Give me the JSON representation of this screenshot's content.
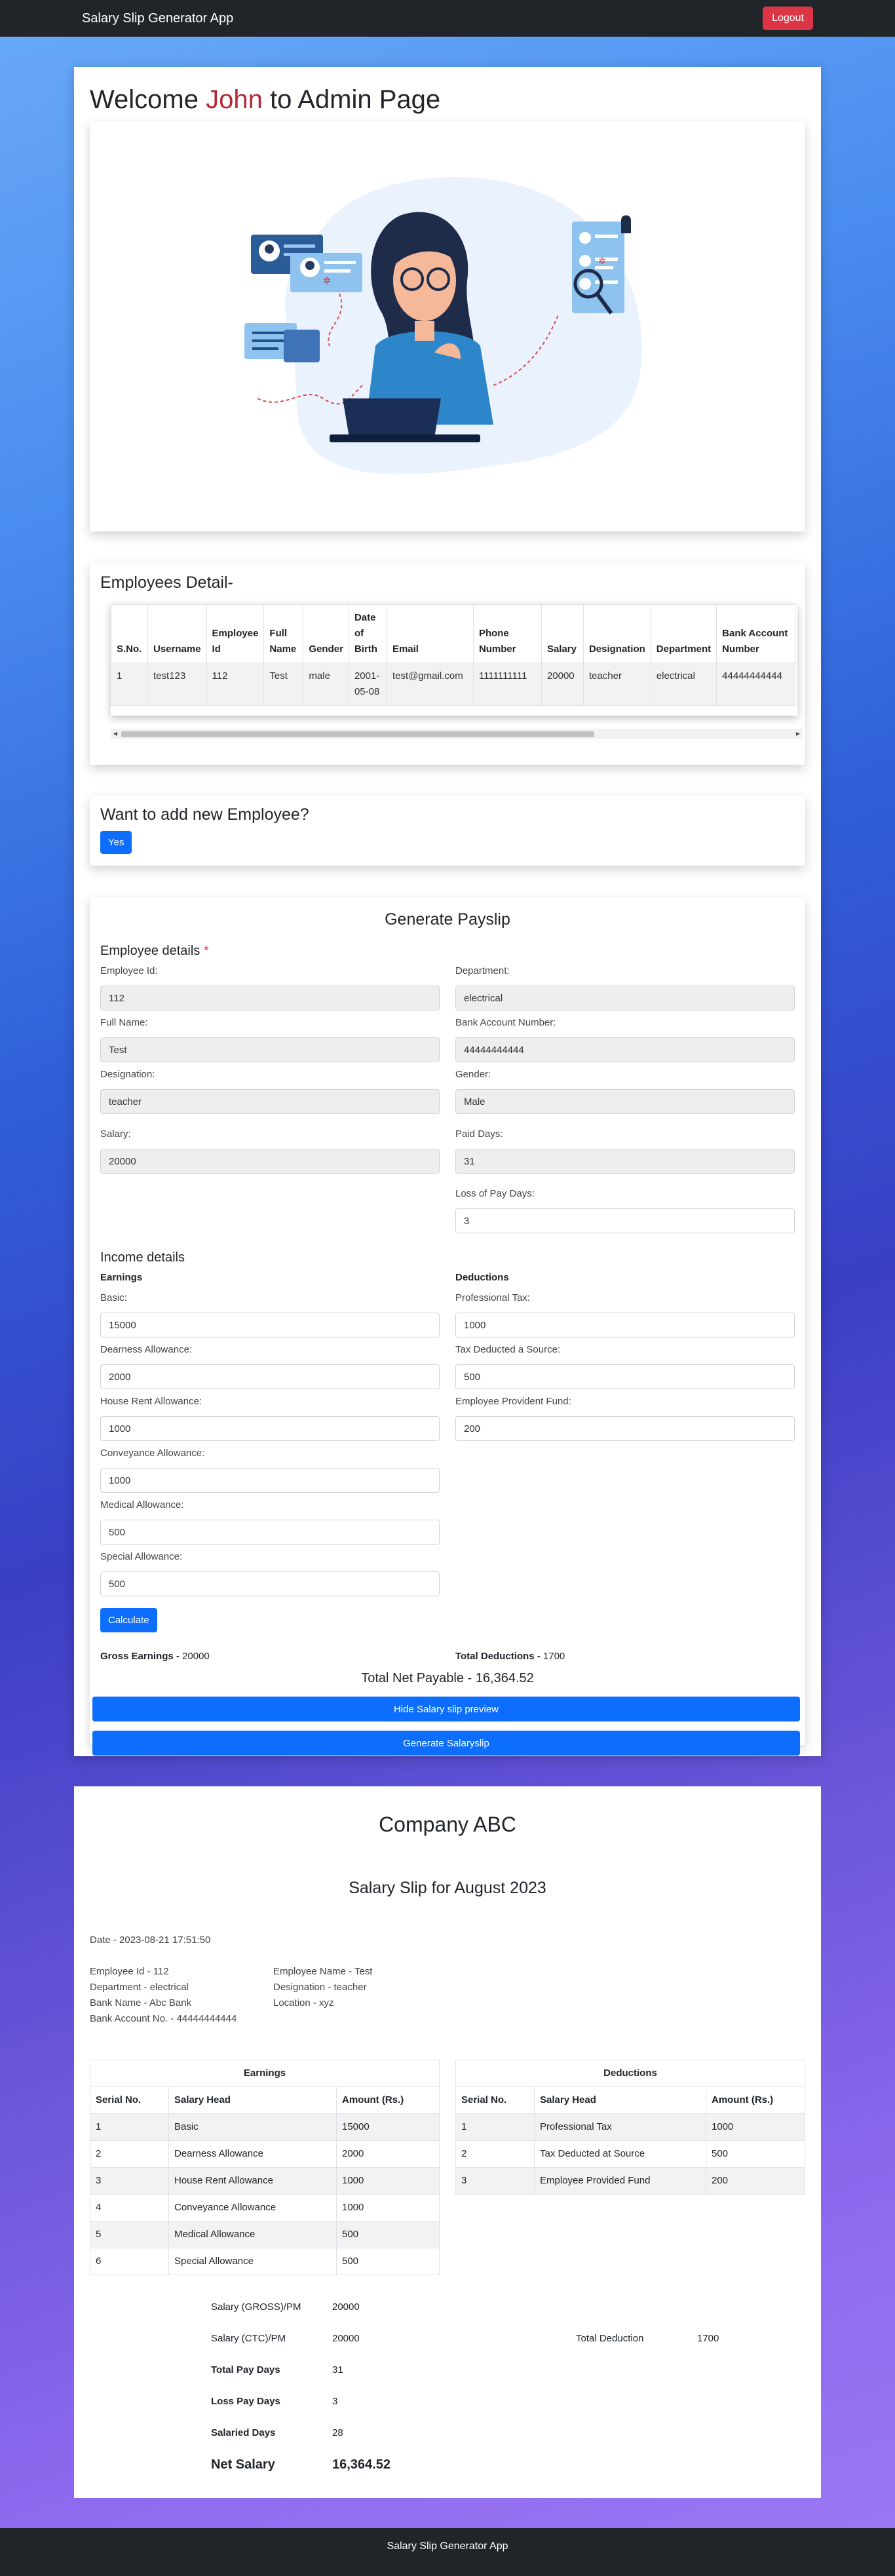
{
  "nav": {
    "brand": "Salary Slip Generator App",
    "logout": "Logout"
  },
  "welcome": {
    "prefix": "Welcome ",
    "name": "John",
    "suffix": " to Admin Page"
  },
  "employees": {
    "title": "Employees Detail-",
    "headers": [
      "S.No.",
      "Username",
      "Employee Id",
      "Full Name",
      "Gender",
      "Date of Birth",
      "Email",
      "Phone Number",
      "Salary",
      "Designation",
      "Department",
      "Bank Account Number"
    ],
    "rows": [
      [
        "1",
        "test123",
        "112",
        "Test",
        "male",
        "2001-05-08",
        "test@gmail.com",
        "1111111111",
        "20000",
        "teacher",
        "electrical",
        "44444444444"
      ]
    ]
  },
  "add_employee": {
    "title": "Want to add new Employee?",
    "button": "Yes"
  },
  "payslip_form": {
    "title": "Generate Payslip",
    "employee_details_title": "Employee details",
    "required_mark": "*",
    "employee_id": {
      "label": "Employee Id:",
      "value": "112"
    },
    "department": {
      "label": "Department:",
      "value": "electrical"
    },
    "full_name": {
      "label": "Full Name:",
      "value": "Test"
    },
    "bank_account": {
      "label": "Bank Account Number:",
      "value": "44444444444"
    },
    "designation": {
      "label": "Designation:",
      "value": "teacher"
    },
    "gender": {
      "label": "Gender:",
      "value": "Male"
    },
    "salary": {
      "label": "Salary:",
      "value": "20000"
    },
    "paid_days": {
      "label": "Paid Days:",
      "value": "31"
    },
    "loss_of_pay": {
      "label": "Loss of Pay Days:",
      "value": "3"
    },
    "income_title": "Income details",
    "earnings_title": "Earnings",
    "deductions_title": "Deductions",
    "basic": {
      "label": "Basic:",
      "value": "15000"
    },
    "dearness": {
      "label": "Dearness Allowance:",
      "value": "2000"
    },
    "hra": {
      "label": "House Rent Allowance:",
      "value": "1000"
    },
    "conveyance": {
      "label": "Conveyance Allowance:",
      "value": "1000"
    },
    "medical": {
      "label": "Medical Allowance:",
      "value": "500"
    },
    "special": {
      "label": "Special Allowance:",
      "value": "500"
    },
    "professional_tax": {
      "label": "Professional Tax:",
      "value": "1000"
    },
    "tds": {
      "label": "Tax Deducted a Source:",
      "value": "500"
    },
    "epf": {
      "label": "Employee Provident Fund:",
      "value": "200"
    },
    "calculate": "Calculate",
    "gross_label": "Gross Earnings - ",
    "gross_value": "20000",
    "total_ded_label": "Total Deductions - ",
    "total_ded_value": "1700",
    "net_payable": "Total Net Payable - 16,364.52",
    "hide_preview": "Hide Salary slip preview",
    "generate": "Generate Salaryslip"
  },
  "slip": {
    "company": "Company ABC",
    "title": "Salary Slip for August 2023",
    "date": "Date - 2023-08-21 17:51:50",
    "info_left": [
      "Employee Id - 112",
      "Department - electrical",
      "Bank Name - Abc Bank",
      "Bank Account No. - 44444444444"
    ],
    "info_right": [
      "Employee Name - Test",
      "Designation - teacher",
      "Location - xyz"
    ],
    "earnings": {
      "caption": "Earnings",
      "headers": [
        "Serial No.",
        "Salary Head",
        "Amount (Rs.)"
      ],
      "rows": [
        [
          "1",
          "Basic",
          "15000"
        ],
        [
          "2",
          "Dearness Allowance",
          "2000"
        ],
        [
          "3",
          "House Rent Allowance",
          "1000"
        ],
        [
          "4",
          "Conveyance Allowance",
          "1000"
        ],
        [
          "5",
          "Medical Allowance",
          "500"
        ],
        [
          "6",
          "Special Allowance",
          "500"
        ]
      ]
    },
    "deductions": {
      "caption": "Deductions",
      "headers": [
        "Serial No.",
        "Salary Head",
        "Amount (Rs.)"
      ],
      "rows": [
        [
          "1",
          "Professional Tax",
          "1000"
        ],
        [
          "2",
          "Tax Deducted at Source",
          "500"
        ],
        [
          "3",
          "Employee Provided Fund",
          "200"
        ]
      ]
    },
    "summary": {
      "gross_label": "Salary (GROSS)/PM",
      "gross_value": "20000",
      "ctc_label": "Salary (CTC)/PM",
      "ctc_value": "20000",
      "total_ded_label": "Total Deduction",
      "total_ded_value": "1700",
      "pay_days_label": "Total Pay Days",
      "pay_days_value": "31",
      "loss_days_label": "Loss Pay Days",
      "loss_days_value": "3",
      "salaried_label": "Salaried Days",
      "salaried_value": "28",
      "net_label": "Net Salary",
      "net_value": "16,364.52"
    }
  },
  "footer": {
    "text": "Salary Slip Generator App"
  }
}
